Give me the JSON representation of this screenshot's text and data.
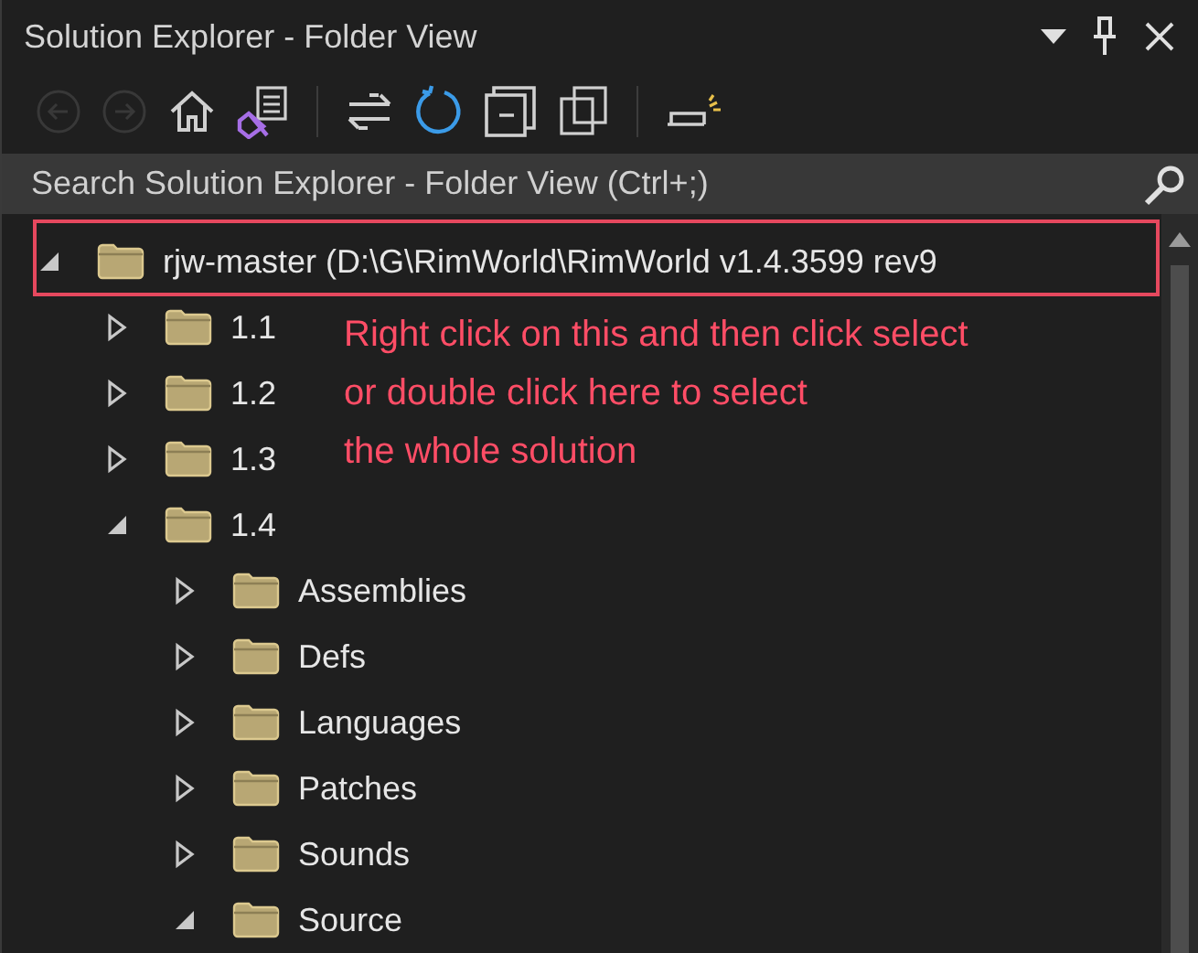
{
  "panel": {
    "title": "Solution Explorer - Folder View"
  },
  "toolbar": [
    {
      "kind": "back",
      "disabled": true
    },
    {
      "kind": "forward",
      "disabled": true
    },
    {
      "kind": "home",
      "disabled": false
    },
    {
      "kind": "switch-views",
      "disabled": false
    },
    {
      "kind": "separator"
    },
    {
      "kind": "sync",
      "disabled": false
    },
    {
      "kind": "refresh",
      "disabled": false
    },
    {
      "kind": "collapse-all",
      "disabled": false
    },
    {
      "kind": "show-all",
      "disabled": false
    },
    {
      "kind": "separator"
    },
    {
      "kind": "preview",
      "disabled": false
    }
  ],
  "search": {
    "placeholder": "Search Solution Explorer - Folder View (Ctrl+;)"
  },
  "tree": [
    {
      "label": "rjw-master (D:\\G\\RimWorld\\RimWorld v1.4.3599 rev9",
      "expanded": true,
      "children": [
        {
          "label": "1.1",
          "expanded": false
        },
        {
          "label": "1.2",
          "expanded": false
        },
        {
          "label": "1.3",
          "expanded": false
        },
        {
          "label": "1.4",
          "expanded": true,
          "children": [
            {
              "label": "Assemblies",
              "expanded": false
            },
            {
              "label": "Defs",
              "expanded": false
            },
            {
              "label": "Languages",
              "expanded": false
            },
            {
              "label": "Patches",
              "expanded": false
            },
            {
              "label": "Sounds",
              "expanded": false
            },
            {
              "label": "Source",
              "expanded": true
            }
          ]
        }
      ]
    }
  ],
  "annotation": {
    "lines": [
      "Right click on this and then click select",
      "or double click here to select",
      "the whole solution"
    ]
  }
}
